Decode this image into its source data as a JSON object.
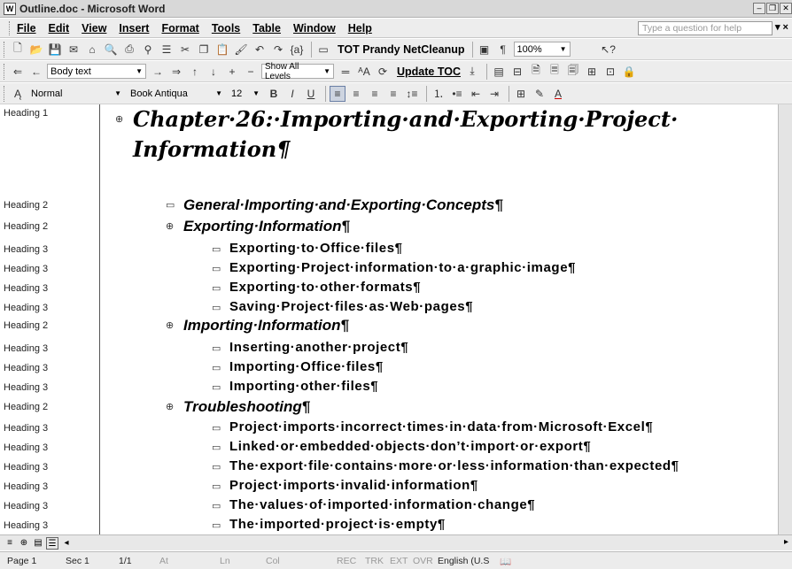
{
  "window": {
    "title": "Outline.doc - Microsoft Word"
  },
  "menu": [
    "File",
    "Edit",
    "View",
    "Insert",
    "Format",
    "Tools",
    "Table",
    "Window",
    "Help"
  ],
  "help_placeholder": "Type a question for help",
  "standard_toolbar": {
    "tot_label": "TOT Prandy NetCleanup",
    "zoom": "100%"
  },
  "outlining_toolbar": {
    "style": "Body text",
    "show_level": "Show All Levels",
    "update_toc": "Update TOC"
  },
  "formatting_toolbar": {
    "style": "Normal",
    "font": "Book Antiqua",
    "size": "12"
  },
  "outline": [
    {
      "style": "Heading 1",
      "text": "Chapter·26:·Importing·and·Exporting·Project·",
      "cont": "Information¶",
      "symbol": "⊕"
    },
    {
      "style": "Heading 2",
      "text": "General·Importing·and·Exporting·Concepts¶",
      "symbol": "▭"
    },
    {
      "style": "Heading 2",
      "text": "Exporting·Information¶",
      "symbol": "⊕"
    },
    {
      "style": "Heading 3",
      "text": "Exporting·to·Office·files¶",
      "symbol": "▭"
    },
    {
      "style": "Heading 3",
      "text": "Exporting·Project·information·to·a·graphic·image¶",
      "symbol": "▭"
    },
    {
      "style": "Heading 3",
      "text": "Exporting·to·other·formats¶",
      "symbol": "▭"
    },
    {
      "style": "Heading 3",
      "text": "Saving·Project·files·as·Web·pages¶",
      "symbol": "▭"
    },
    {
      "style": "Heading 2",
      "text": "Importing·Information¶",
      "symbol": "⊕"
    },
    {
      "style": "Heading 3",
      "text": "Inserting·another·project¶",
      "symbol": "▭"
    },
    {
      "style": "Heading 3",
      "text": "Importing·Office·files¶",
      "symbol": "▭"
    },
    {
      "style": "Heading 3",
      "text": "Importing·other·files¶",
      "symbol": "▭"
    },
    {
      "style": "Heading 2",
      "text": "Troubleshooting¶",
      "symbol": "⊕"
    },
    {
      "style": "Heading 3",
      "text": "Project·imports·incorrect·times·in·data·from·Microsoft·Excel¶",
      "symbol": "▭"
    },
    {
      "style": "Heading 3",
      "text": "Linked·or·embedded·objects·don’t·import·or·export¶",
      "symbol": "▭"
    },
    {
      "style": "Heading 3",
      "text": "The·export·file·contains·more·or·less·information·than·expected¶",
      "symbol": "▭"
    },
    {
      "style": "Heading 3",
      "text": "Project·imports·invalid·information¶",
      "symbol": "▭"
    },
    {
      "style": "Heading 3",
      "text": "The·values·of·imported·information·change¶",
      "symbol": "▭"
    },
    {
      "style": "Heading 3",
      "text": "The·imported·project·is·empty¶",
      "symbol": "▭"
    }
  ],
  "status": {
    "page": "Page 1",
    "sec": "Sec 1",
    "pages": "1/1",
    "at": "At",
    "ln": "Ln",
    "col": "Col",
    "rec": "REC",
    "trk": "TRK",
    "ext": "EXT",
    "ovr": "OVR",
    "lang": "English (U.S"
  }
}
